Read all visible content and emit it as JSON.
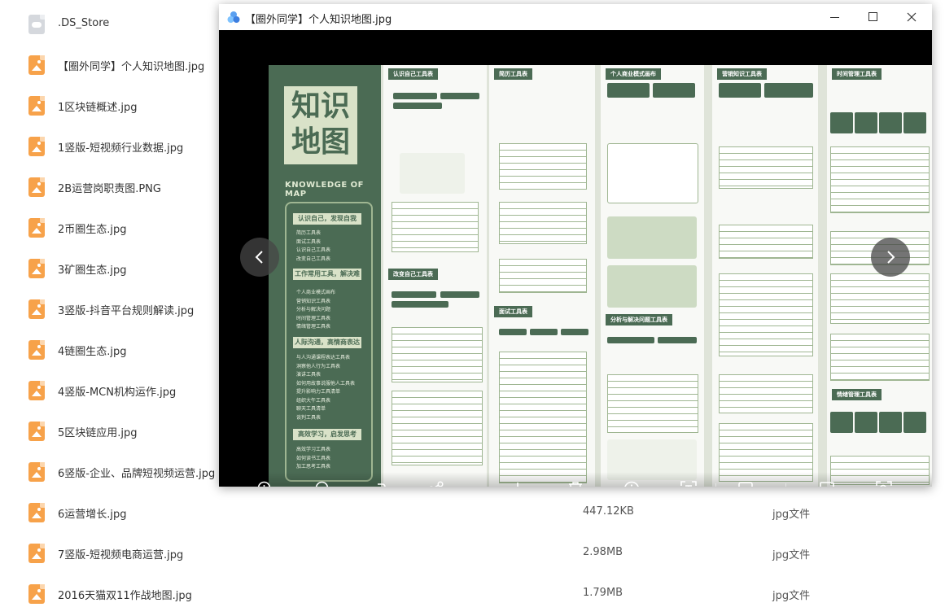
{
  "files": [
    {
      "name": ".DS_Store",
      "size": "",
      "type": "",
      "icon": "cloud-file-icon"
    },
    {
      "name": "【圈外同学】个人知识地图.jpg",
      "size": "",
      "type": "",
      "icon": "image-file-icon"
    },
    {
      "name": "1区块链概述.jpg",
      "size": "",
      "type": "",
      "icon": "image-file-icon"
    },
    {
      "name": "1竖版-短视频行业数据.jpg",
      "size": "",
      "type": "",
      "icon": "image-file-icon"
    },
    {
      "name": "2B运营岗职责图.PNG",
      "size": "",
      "type": "",
      "icon": "image-file-icon"
    },
    {
      "name": "2币圈生态.jpg",
      "size": "",
      "type": "",
      "icon": "image-file-icon"
    },
    {
      "name": "3矿圈生态.jpg",
      "size": "",
      "type": "",
      "icon": "image-file-icon"
    },
    {
      "name": "3竖版-抖音平台规则解读.jpg",
      "size": "",
      "type": "",
      "icon": "image-file-icon"
    },
    {
      "name": "4链圈生态.jpg",
      "size": "",
      "type": "",
      "icon": "image-file-icon"
    },
    {
      "name": "4竖版-MCN机构运作.jpg",
      "size": "",
      "type": "",
      "icon": "image-file-icon"
    },
    {
      "name": "5区块链应用.jpg",
      "size": "",
      "type": "",
      "icon": "image-file-icon"
    },
    {
      "name": "6竖版-企业、品牌短视频运营.jpg",
      "size": "",
      "type": "",
      "icon": "image-file-icon"
    },
    {
      "name": "6运营增长.jpg",
      "size": "447.12KB",
      "type": "jpg文件",
      "icon": "image-file-icon"
    },
    {
      "name": "7竖版-短视频电商运营.jpg",
      "size": "2.98MB",
      "type": "jpg文件",
      "icon": "image-file-icon"
    },
    {
      "name": "2016天猫双11作战地图.jpg",
      "size": "1.79MB",
      "type": "jpg文件",
      "icon": "image-file-icon"
    }
  ],
  "viewer": {
    "title": "【圈外同学】个人知识地图.jpg",
    "poster": {
      "title_line1": "知识",
      "title_line2": "地图",
      "subtitle": "KNOWLEDGE OF MAP",
      "sections": [
        "认识自己，发现自我",
        "工作常用工具，解决难题",
        "人际沟通，高情商表达",
        "高效学习，启发思考"
      ],
      "section1_items": [
        "简历工具表",
        "面试工具表",
        "认识自己工具表",
        "改变自己工具表"
      ],
      "section2_items": [
        "个人商业模式画布",
        "营销知识工具表",
        "分析与解决问题",
        "时间管理工具表",
        "情绪管理工具表"
      ],
      "section3_items": [
        "与人沟通课程表达工具表",
        "洞察他人行为工具表",
        "演讲工具表",
        "如何用故事说服他人工具表",
        "提升影响力工具清单",
        "组织大午工具表",
        "聊天工具清单",
        "谈判工具表"
      ],
      "section4_items": [
        "高效学习工具表",
        "如何读书工具表",
        "加工思考工具表"
      ],
      "column_heads": [
        "认识自己工具表",
        "简历工具表",
        "个人商业模式画布",
        "营销知识工具表",
        "时间管理工具表"
      ]
    },
    "controls": {
      "prev": "‹",
      "next": "›",
      "tools": [
        "zoom-in-icon",
        "zoom-out-icon",
        "rotate-icon",
        "share-icon",
        "download-icon",
        "delete-icon",
        "info-icon",
        "text-recognize-icon",
        "edit-icon",
        "fullscreen-icon",
        "image-search-icon"
      ]
    }
  },
  "colors": {
    "accent_green": "#4b6b54",
    "file_icon": "#f7a24a"
  }
}
